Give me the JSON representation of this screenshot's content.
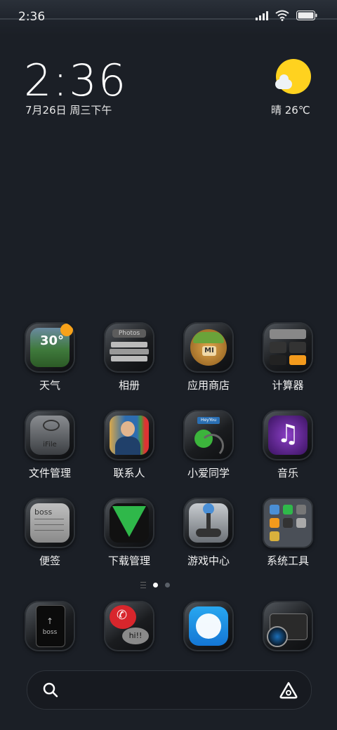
{
  "status": {
    "time": "2:36"
  },
  "widget": {
    "clock": "2:36",
    "date": "7月26日 周三下午",
    "weather": "晴 26℃"
  },
  "apps": [
    {
      "label": "天气",
      "icon": "weather-icon"
    },
    {
      "label": "相册",
      "icon": "photos-icon",
      "text": "Photos"
    },
    {
      "label": "应用商店",
      "icon": "app-store-icon",
      "text": "MI"
    },
    {
      "label": "计算器",
      "icon": "calculator-icon"
    },
    {
      "label": "文件管理",
      "icon": "file-manager-icon",
      "text": "iFile"
    },
    {
      "label": "联系人",
      "icon": "contacts-icon"
    },
    {
      "label": "小爱同学",
      "icon": "assistant-icon",
      "text": "HeyYou"
    },
    {
      "label": "音乐",
      "icon": "music-icon"
    },
    {
      "label": "便签",
      "icon": "notes-icon",
      "text": "boss"
    },
    {
      "label": "下载管理",
      "icon": "download-icon"
    },
    {
      "label": "游戏中心",
      "icon": "game-center-icon"
    },
    {
      "label": "系统工具",
      "icon": "system-tools-folder-icon"
    }
  ],
  "dock": [
    {
      "icon": "phone-icon",
      "text": "boss"
    },
    {
      "icon": "messages-icon",
      "text": "hi!!"
    },
    {
      "icon": "browser-icon"
    },
    {
      "icon": "camera-icon"
    }
  ],
  "weather_tile_temp": "30°"
}
